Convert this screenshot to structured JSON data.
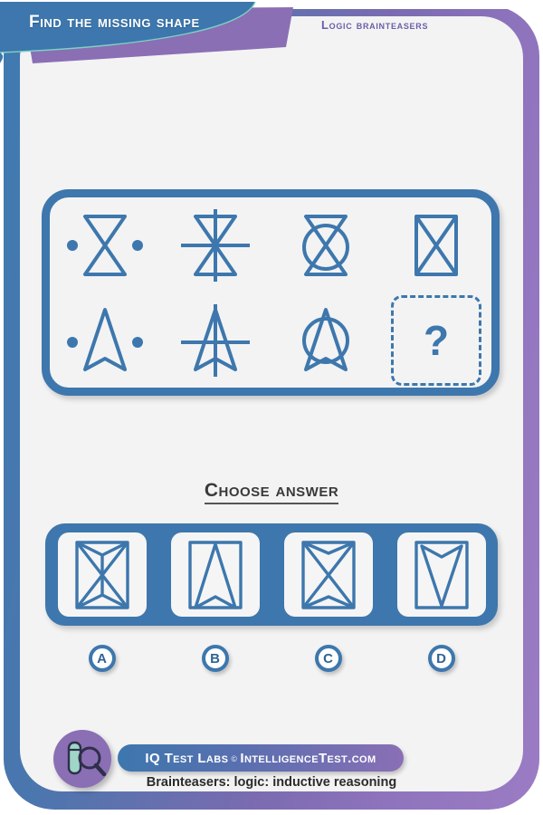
{
  "header": {
    "title": "Find the missing shape",
    "kicker": "Logic brainteasers"
  },
  "puzzle": {
    "cells": [
      {
        "id": "r1c1",
        "name": "hourglass-with-dots",
        "label": "hourglass with two dots"
      },
      {
        "id": "r1c2",
        "name": "hourglass-with-cross-lines",
        "label": "hourglass with vertical and horizontal lines"
      },
      {
        "id": "r1c3",
        "name": "hourglass-with-circle",
        "label": "hourglass with circle"
      },
      {
        "id": "r1c4",
        "name": "hourglass-in-rectangle",
        "label": "hourglass inside rectangle"
      },
      {
        "id": "r2c1",
        "name": "arrow-with-dots",
        "label": "arrow with two dots"
      },
      {
        "id": "r2c2",
        "name": "arrow-with-cross-lines",
        "label": "arrow with vertical and horizontal lines"
      },
      {
        "id": "r2c3",
        "name": "arrow-with-circle",
        "label": "arrow with circle"
      },
      {
        "id": "r2c4",
        "name": "missing-cell",
        "label": "?"
      }
    ],
    "missing_marker": "?"
  },
  "choose": {
    "heading": "Choose answer"
  },
  "answers": {
    "options": [
      {
        "letter": "A",
        "name": "option-a-shape",
        "label": "hourglass and double arrow in rectangle"
      },
      {
        "letter": "B",
        "name": "option-b-shape",
        "label": "up arrow in rectangle"
      },
      {
        "letter": "C",
        "name": "option-c-shape",
        "label": "hourglass in rectangle"
      },
      {
        "letter": "D",
        "name": "option-d-shape",
        "label": "down arrow in rectangle"
      }
    ]
  },
  "footer": {
    "brand_main": "IQ Test Labs",
    "brand_reg": "©",
    "brand_site": "IntelligenceTest.com",
    "caption": "Brainteasers: logic: inductive reasoning"
  },
  "colors": {
    "blue": "#3d77ad",
    "purple": "#8a6fb5",
    "kicker": "#6a5fa8",
    "panel_bg": "#f3f3f3",
    "tube": "#9fd6c8"
  }
}
